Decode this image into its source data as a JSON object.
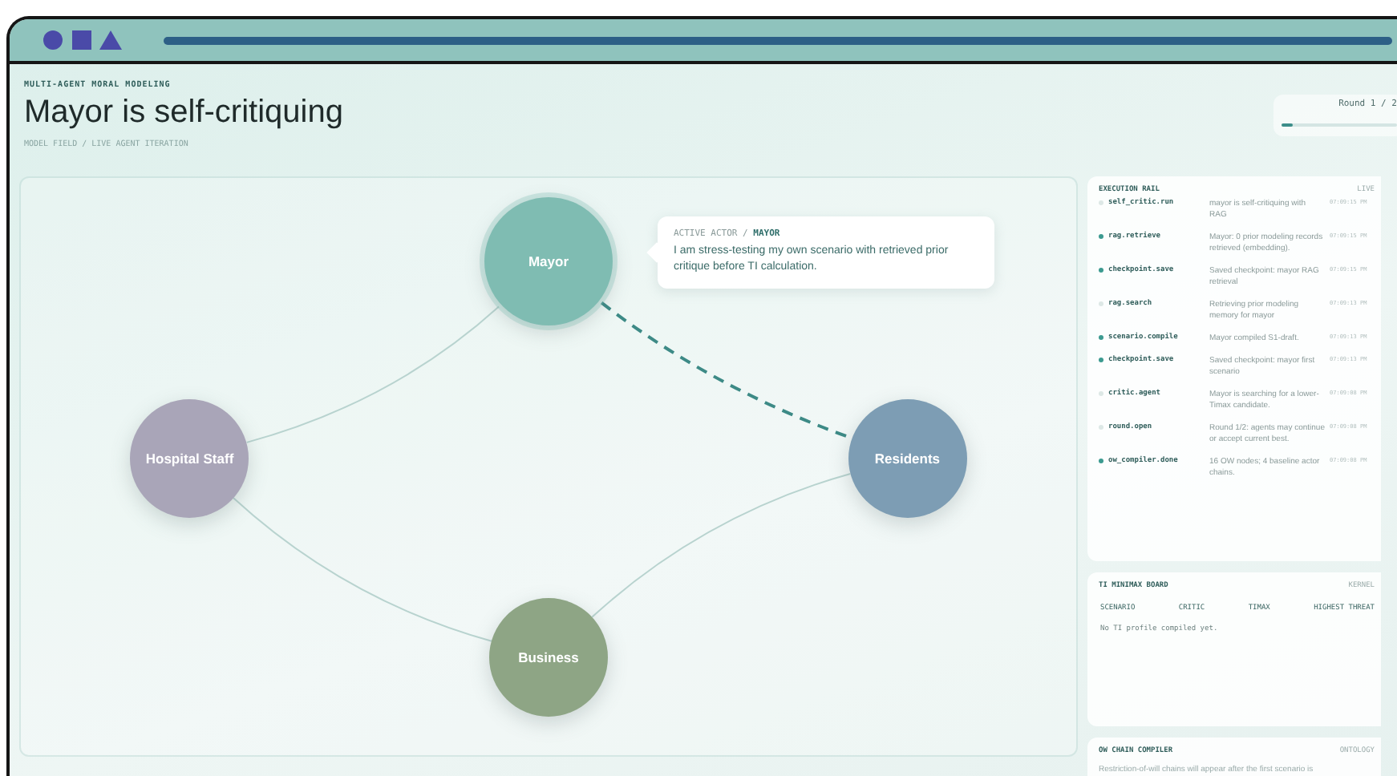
{
  "header": {
    "eyebrow": "MULTI-AGENT MORAL MODELING",
    "title": "Mayor is self-critiquing",
    "subtitle": "MODEL FIELD / LIVE AGENT ITERATION"
  },
  "round": {
    "label": "Round 1 / 2",
    "level": 0.1
  },
  "graph": {
    "nodes": [
      {
        "label": "Mayor",
        "color": "#7fbcb2",
        "active": true
      },
      {
        "label": "Hospital Staff",
        "color": "#a9a5b8",
        "active": false
      },
      {
        "label": "Residents",
        "color": "#7d9db4",
        "active": false
      },
      {
        "label": "Business",
        "color": "#8ea585",
        "active": false
      }
    ],
    "edges": [
      {
        "active": false
      },
      {
        "active": false
      },
      {
        "active": false
      },
      {
        "active": true
      }
    ],
    "callout": {
      "label": "ACTIVE ACTOR /",
      "actor": "MAYOR",
      "text": "I am stress-testing my own scenario with retrieved prior critique before TI calculation."
    }
  },
  "execution_rail": {
    "title": "EXECUTION RAIL",
    "badge": "LIVE",
    "events": [
      {
        "name": "self_critic.run",
        "text": "mayor is self-critiquing with RAG",
        "time": "07:09:15 PM",
        "marked": false
      },
      {
        "name": "rag.retrieve",
        "text": "Mayor: 0 prior modeling records retrieved (embedding).",
        "time": "07:09:15 PM",
        "marked": true
      },
      {
        "name": "checkpoint.save",
        "text": "Saved checkpoint: mayor RAG retrieval",
        "time": "07:09:15 PM",
        "marked": true
      },
      {
        "name": "rag.search",
        "text": "Retrieving prior modeling memory for mayor",
        "time": "07:09:13 PM",
        "marked": false
      },
      {
        "name": "scenario.compile",
        "text": "Mayor compiled S1-draft.",
        "time": "07:09:13 PM",
        "marked": true
      },
      {
        "name": "checkpoint.save",
        "text": "Saved checkpoint: mayor first scenario",
        "time": "07:09:13 PM",
        "marked": true
      },
      {
        "name": "critic.agent",
        "text": "Mayor is searching for a lower-Timax candidate.",
        "time": "07:09:08 PM",
        "marked": false
      },
      {
        "name": "round.open",
        "text": "Round 1/2: agents may continue or accept current best.",
        "time": "07:09:08 PM",
        "marked": false
      },
      {
        "name": "ow_compiler.done",
        "text": "16 OW nodes; 4 baseline actor chains.",
        "time": "07:09:08 PM",
        "marked": true
      }
    ]
  },
  "minimax_board": {
    "title": "TI MINIMAX BOARD",
    "badge": "KERNEL",
    "columns": [
      "SCENARIO",
      "CRITIC",
      "TIMAX",
      "HIGHEST THREAT"
    ],
    "empty": "No TI profile compiled yet."
  },
  "ow_chain_compiler": {
    "title": "OW CHAIN COMPILER",
    "badge": "ONTOLOGY",
    "text": "Restriction-of-will chains will appear after the first scenario is"
  }
}
